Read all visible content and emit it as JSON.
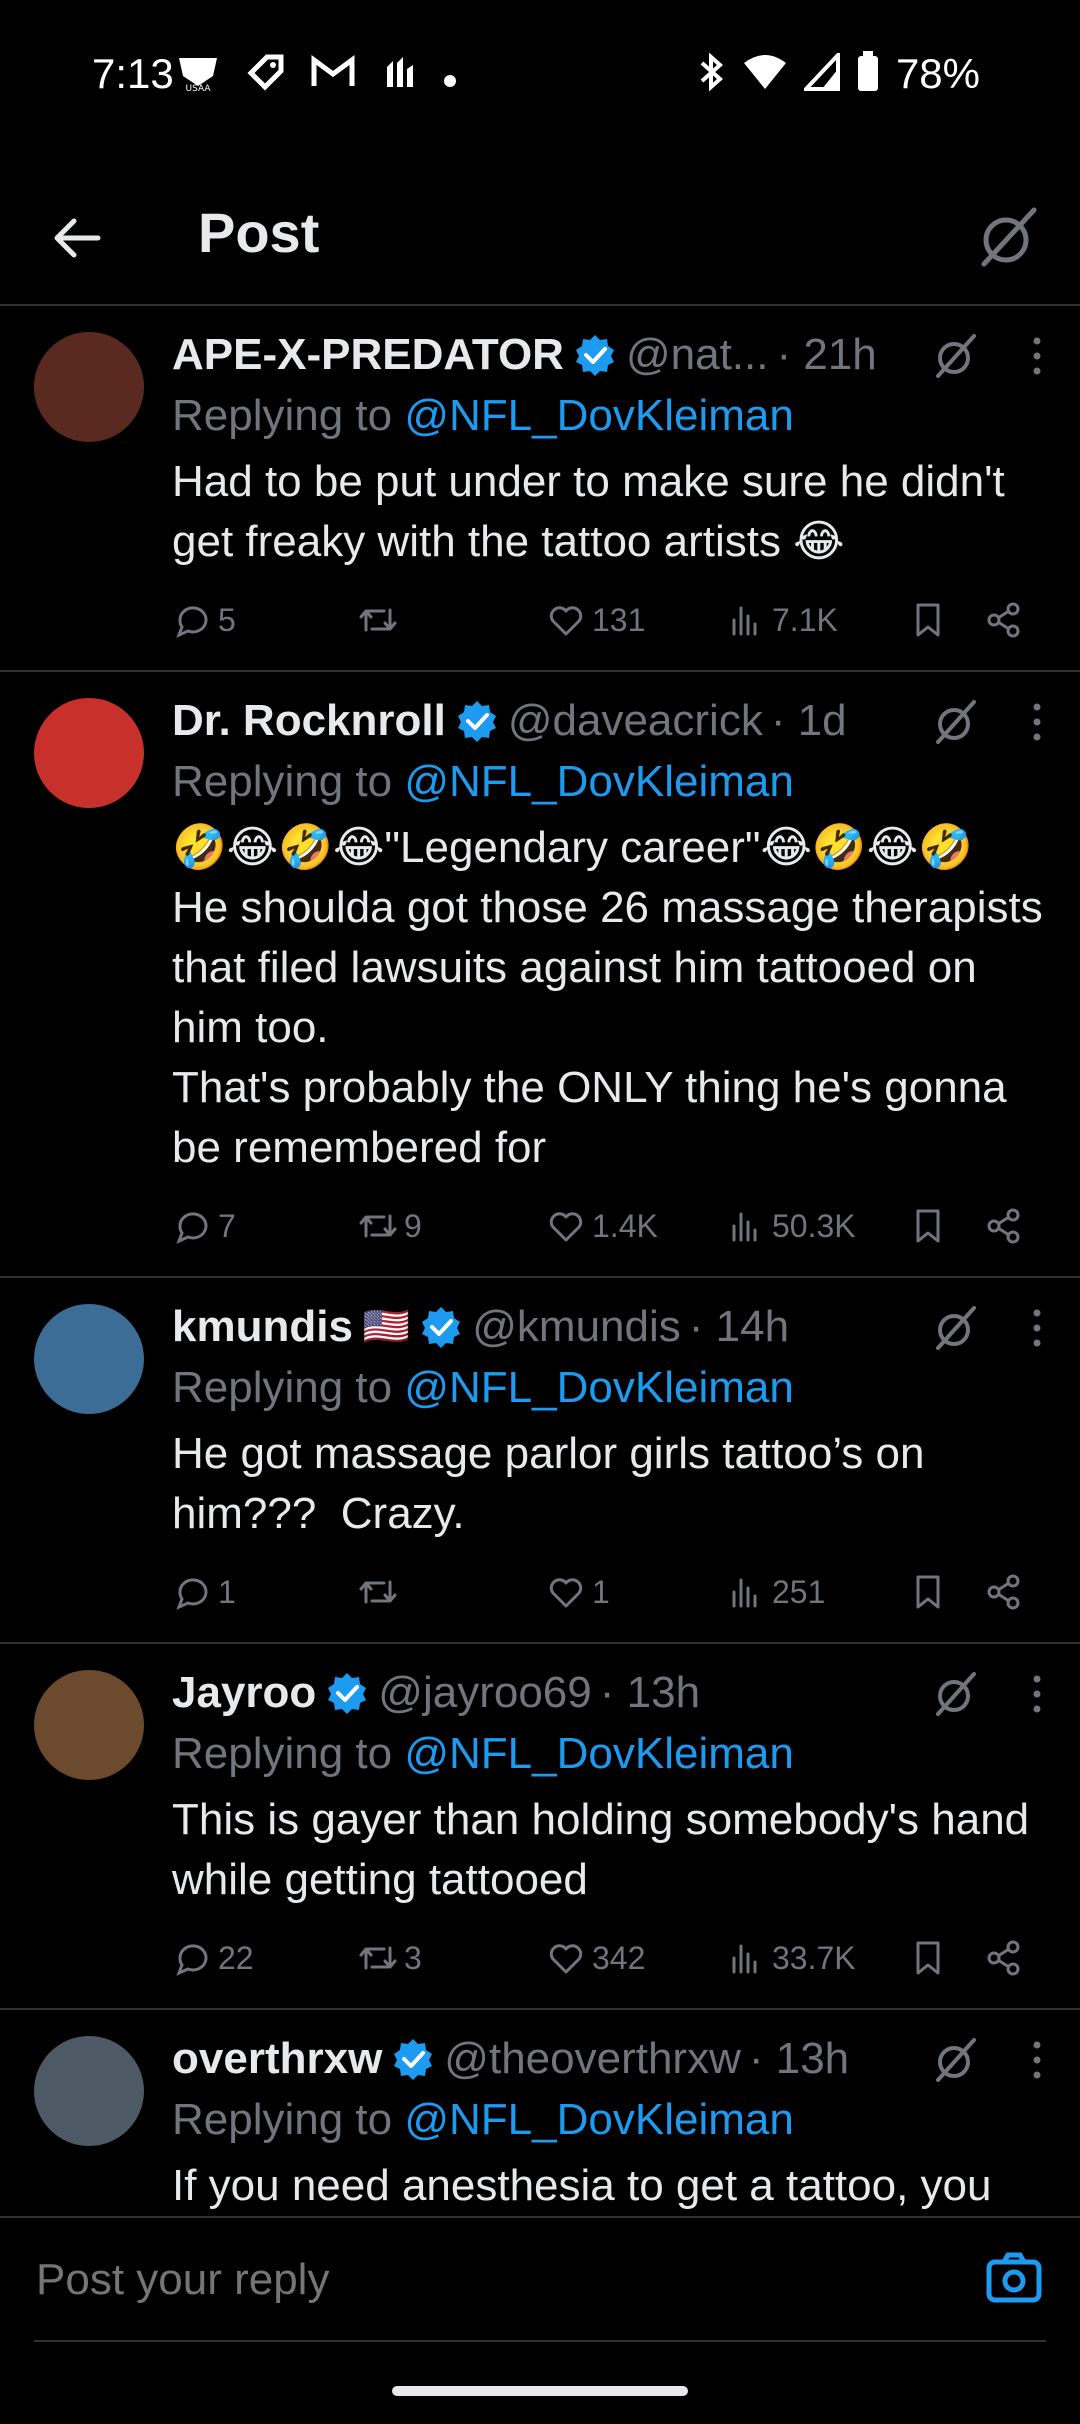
{
  "status": {
    "time": "7:13",
    "battery": "78%",
    "left_icons": [
      "usaa-icon",
      "tag-icon",
      "gmail-icon",
      "app-icon",
      "dot-icon"
    ]
  },
  "header": {
    "title": "Post"
  },
  "tweets": [
    {
      "name": "APE-X-PREDATOR",
      "handle": "@nat...",
      "time": "· 21h",
      "replying_prefix": "Replying to ",
      "replying_to": "@NFL_DovKleiman",
      "text": "Had to be put under to make sure he didn't get freaky with the tattoo artists 😂",
      "replies": "5",
      "retweets": "",
      "likes": "131",
      "views": "7.1K",
      "avatar_color": "#5a2a20"
    },
    {
      "name": "Dr. Rocknroll",
      "handle": "@daveacrick",
      "time": "· 1d",
      "replying_prefix": "Replying to ",
      "replying_to": "@NFL_DovKleiman",
      "text": "🤣😂🤣😂\"Legendary career\"😂🤣😂🤣\nHe shoulda got those 26 massage therapists that filed lawsuits against him tattooed on him too.\nThat's probably the ONLY thing he's gonna be remembered for",
      "replies": "7",
      "retweets": "9",
      "likes": "1.4K",
      "views": "50.3K",
      "avatar_color": "#c8302c"
    },
    {
      "name": "kmundis",
      "flag": "🇺🇸",
      "handle": "@kmundis",
      "time": "· 14h",
      "replying_prefix": "Replying to ",
      "replying_to": "@NFL_DovKleiman",
      "text": "He got massage parlor girls tattoo’s on him???  Crazy.",
      "replies": "1",
      "retweets": "",
      "likes": "1",
      "views": "251",
      "avatar_color": "#3b6d96"
    },
    {
      "name": "Jayroo",
      "handle": "@jayroo69",
      "time": "· 13h",
      "replying_prefix": "Replying to ",
      "replying_to": "@NFL_DovKleiman",
      "text": "This is gayer than holding somebody's hand while getting tattooed",
      "replies": "22",
      "retweets": "3",
      "likes": "342",
      "views": "33.7K",
      "avatar_color": "#6b4a2e"
    },
    {
      "name": "overthrxw",
      "handle": "@theoverthrxw",
      "time": "· 13h",
      "replying_prefix": "Replying to ",
      "replying_to": "@NFL_DovKleiman",
      "text": "If you need anesthesia to get a tattoo, you shouldn't get the tattoo",
      "replies": "",
      "retweets": "",
      "likes": "",
      "views": "",
      "avatar_color": "#4d5a66"
    }
  ],
  "reply_bar": {
    "placeholder": "Post your reply"
  },
  "colors": {
    "accent": "#1d9bf0",
    "muted": "#71767b",
    "text": "#e7e9ea",
    "divider": "#2f3336"
  }
}
